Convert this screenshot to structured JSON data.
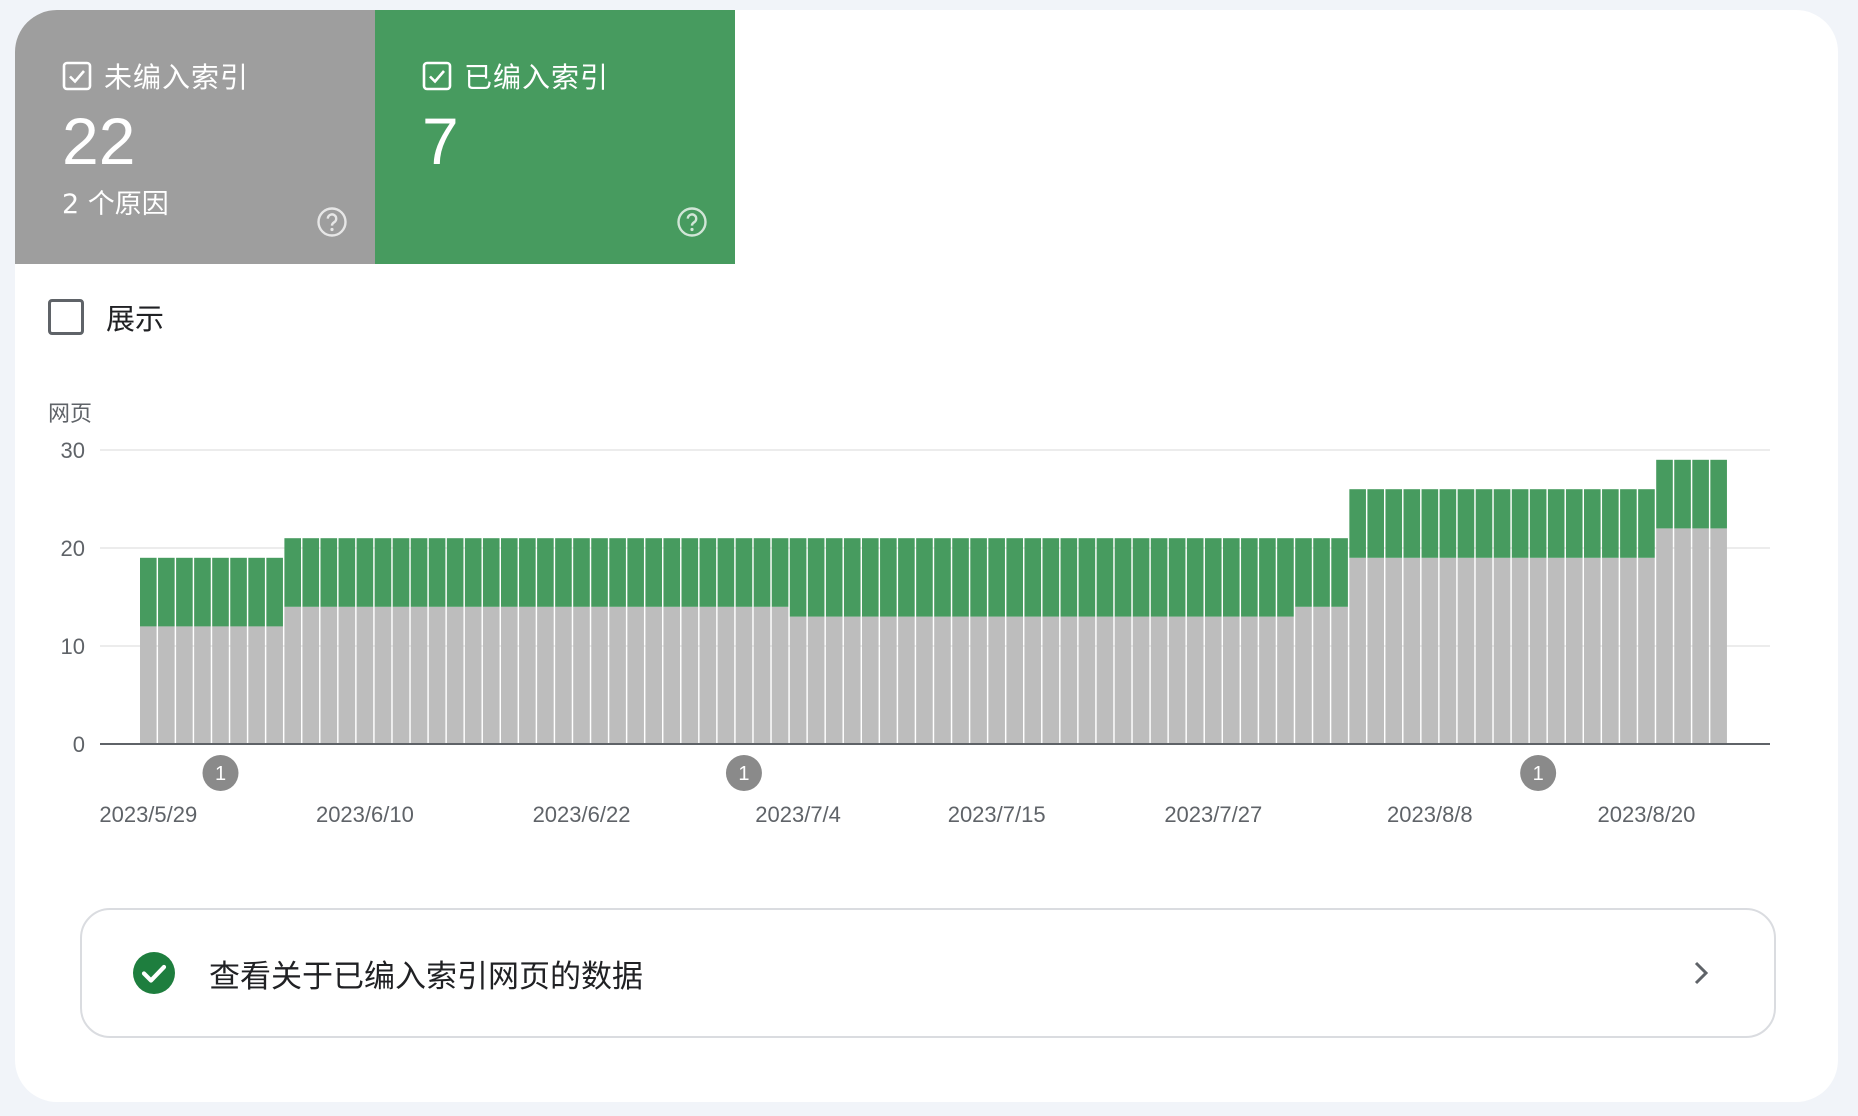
{
  "tiles": [
    {
      "title": "未编入索引",
      "value": "22",
      "subtitle": "2 个原因",
      "color": "#9e9e9e",
      "checked": true,
      "icon": "help-icon"
    },
    {
      "title": "已编入索引",
      "value": "7",
      "subtitle": "",
      "color": "#479b5f",
      "checked": true,
      "icon": "help-icon"
    }
  ],
  "toggle": {
    "label": "展示",
    "checked": false
  },
  "cta": {
    "label": "查看关于已编入索引网页的数据",
    "icon": "check-circle-icon",
    "chevron": "chevron-right-icon"
  },
  "colors": {
    "not_indexed": "#bdbdbd",
    "indexed": "#479b5f",
    "accent": "#1e7e3e"
  },
  "chart_data": {
    "type": "bar",
    "stacked": true,
    "ylabel": "网页",
    "ylim": [
      0,
      30
    ],
    "yticks": [
      0,
      10,
      20,
      30
    ],
    "grid": true,
    "x_tick_labels": [
      "2023/5/29",
      "2023/6/10",
      "2023/6/22",
      "2023/7/4",
      "2023/7/15",
      "2023/7/27",
      "2023/8/8",
      "2023/8/20"
    ],
    "x_tick_indices": [
      0,
      12,
      24,
      36,
      47,
      59,
      71,
      83
    ],
    "annotations": [
      {
        "index": 4,
        "label": "1"
      },
      {
        "index": 33,
        "label": "1"
      },
      {
        "index": 77,
        "label": "1"
      }
    ],
    "bar_count": 90,
    "series": [
      {
        "name": "未编入索引",
        "values": [
          12,
          12,
          12,
          12,
          12,
          12,
          12,
          12,
          14,
          14,
          14,
          14,
          14,
          14,
          14,
          14,
          14,
          14,
          14,
          14,
          14,
          14,
          14,
          14,
          14,
          14,
          14,
          14,
          14,
          14,
          14,
          14,
          14,
          14,
          14,
          14,
          13,
          13,
          13,
          13,
          13,
          13,
          13,
          13,
          13,
          13,
          13,
          13,
          13,
          13,
          13,
          13,
          13,
          13,
          13,
          13,
          13,
          13,
          13,
          13,
          13,
          13,
          13,
          13,
          14,
          14,
          14,
          19,
          19,
          19,
          19,
          19,
          19,
          19,
          19,
          19,
          19,
          19,
          19,
          19,
          19,
          19,
          19,
          19,
          22,
          22,
          22,
          22
        ]
      },
      {
        "name": "已编入索引",
        "values": [
          7,
          7,
          7,
          7,
          7,
          7,
          7,
          7,
          7,
          7,
          7,
          7,
          7,
          7,
          7,
          7,
          7,
          7,
          7,
          7,
          7,
          7,
          7,
          7,
          7,
          7,
          7,
          7,
          7,
          7,
          7,
          7,
          7,
          7,
          7,
          7,
          8,
          8,
          8,
          8,
          8,
          8,
          8,
          8,
          8,
          8,
          8,
          8,
          8,
          8,
          8,
          8,
          8,
          8,
          8,
          8,
          8,
          8,
          8,
          8,
          8,
          8,
          8,
          8,
          7,
          7,
          7,
          7,
          7,
          7,
          7,
          7,
          7,
          7,
          7,
          7,
          7,
          7,
          7,
          7,
          7,
          7,
          7,
          7,
          7,
          7,
          7,
          7
        ]
      }
    ]
  }
}
